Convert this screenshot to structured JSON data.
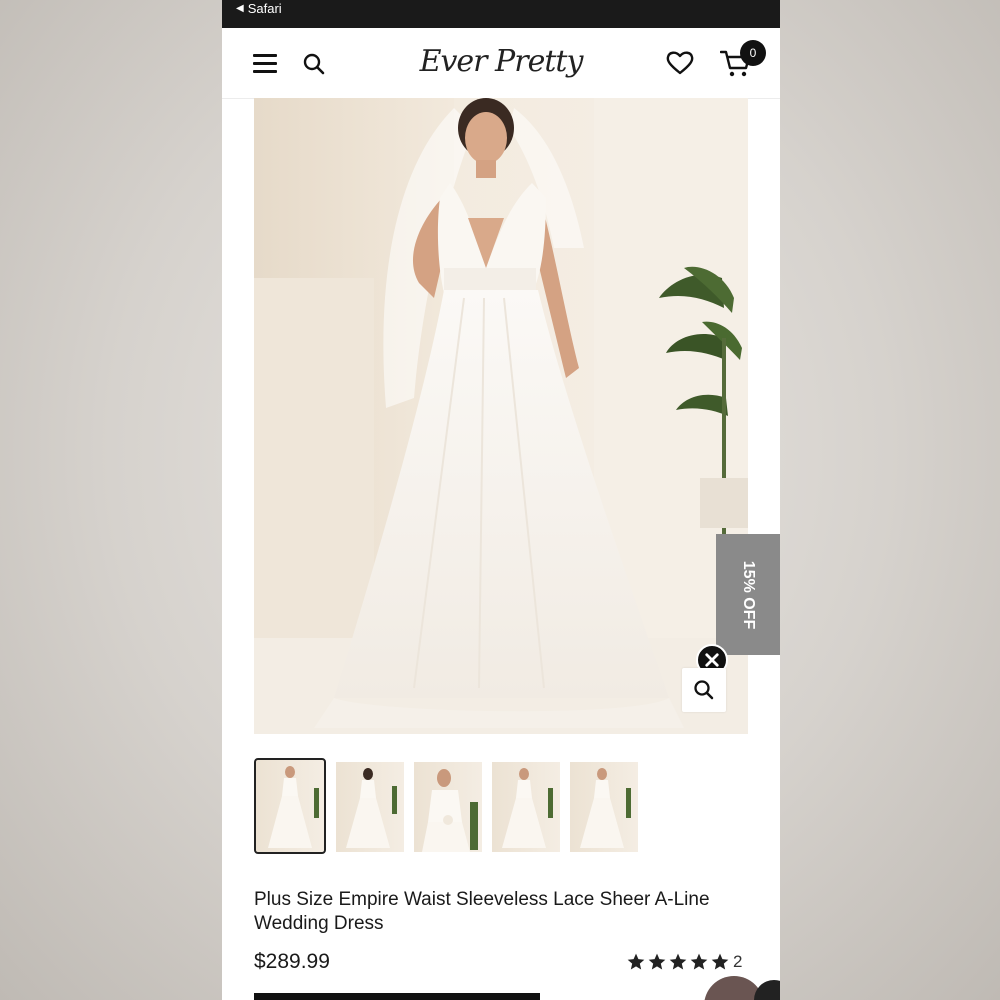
{
  "statusbar": {
    "back_glyph": "◀",
    "app_label": "Safari"
  },
  "header": {
    "brand": "Ever Pretty",
    "cart_count": "0",
    "icons": [
      "menu-icon",
      "search-icon",
      "heart-icon",
      "cart-icon"
    ]
  },
  "promo": {
    "label": "15% OFF"
  },
  "product": {
    "title": "Plus Size Empire Waist Sleeveless Lace Sheer A-Line Wedding Dress",
    "price": "$289.99",
    "rating_stars": 5,
    "review_count": "2"
  },
  "gallery": {
    "thumbnail_count": 5,
    "active_index": 0
  },
  "colors": {
    "accent": "#111111",
    "promo_tab": "#8a8a8a",
    "status_bar": "#1a1a1a"
  }
}
